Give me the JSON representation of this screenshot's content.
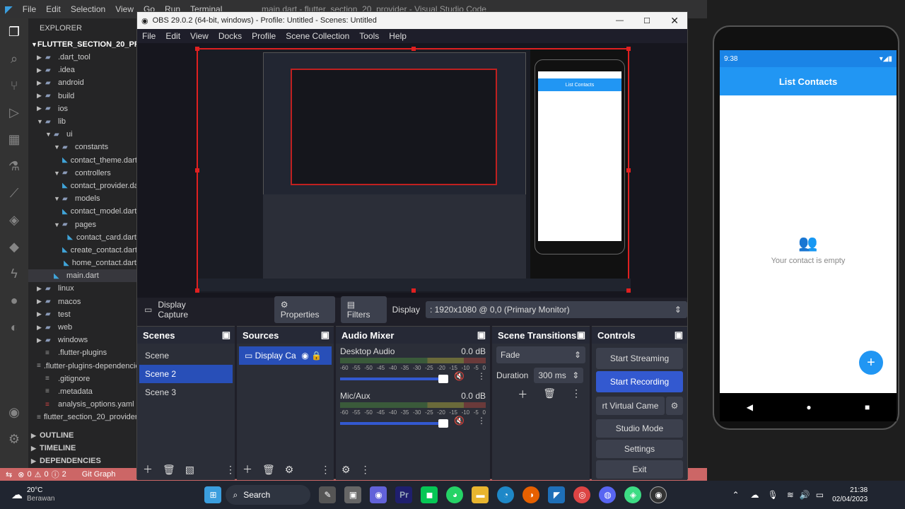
{
  "vscode": {
    "menus": [
      "File",
      "Edit",
      "Selection",
      "View",
      "Go",
      "Run",
      "Terminal",
      "Help"
    ],
    "title": "main.dart - flutter_section_20_provider - Visual Studio Code",
    "explorer_label": "EXPLORER",
    "project": "FLUTTER_SECTION_20_PROVIDER",
    "tree": [
      {
        "label": ".dart_tool",
        "indent": 1,
        "type": "folder",
        "open": false
      },
      {
        "label": ".idea",
        "indent": 1,
        "type": "folder",
        "open": false
      },
      {
        "label": "android",
        "indent": 1,
        "type": "folder",
        "open": false
      },
      {
        "label": "build",
        "indent": 1,
        "type": "folder",
        "open": false
      },
      {
        "label": "ios",
        "indent": 1,
        "type": "folder",
        "open": false
      },
      {
        "label": "lib",
        "indent": 1,
        "type": "folder",
        "open": true
      },
      {
        "label": "ui",
        "indent": 2,
        "type": "folder",
        "open": true
      },
      {
        "label": "constants",
        "indent": 3,
        "type": "folder",
        "open": true
      },
      {
        "label": "contact_theme.dart",
        "indent": 4,
        "type": "dart"
      },
      {
        "label": "controllers",
        "indent": 3,
        "type": "folder",
        "open": true
      },
      {
        "label": "contact_provider.dart",
        "indent": 4,
        "type": "dart"
      },
      {
        "label": "models",
        "indent": 3,
        "type": "folder",
        "open": true
      },
      {
        "label": "contact_model.dart",
        "indent": 4,
        "type": "dart"
      },
      {
        "label": "pages",
        "indent": 3,
        "type": "folder",
        "open": true
      },
      {
        "label": "contact_card.dart",
        "indent": 4,
        "type": "dart"
      },
      {
        "label": "create_contact.dart",
        "indent": 4,
        "type": "dart"
      },
      {
        "label": "home_contact.dart",
        "indent": 4,
        "type": "dart"
      },
      {
        "label": "main.dart",
        "indent": 2,
        "type": "dart",
        "active": true
      },
      {
        "label": "linux",
        "indent": 1,
        "type": "folder",
        "open": false
      },
      {
        "label": "macos",
        "indent": 1,
        "type": "folder",
        "open": false
      },
      {
        "label": "test",
        "indent": 1,
        "type": "folder",
        "open": false
      },
      {
        "label": "web",
        "indent": 1,
        "type": "folder",
        "open": false
      },
      {
        "label": "windows",
        "indent": 1,
        "type": "folder",
        "open": false
      },
      {
        "label": ".flutter-plugins",
        "indent": 1,
        "type": "file"
      },
      {
        "label": ".flutter-plugins-dependencies",
        "indent": 1,
        "type": "file"
      },
      {
        "label": ".gitignore",
        "indent": 1,
        "type": "file"
      },
      {
        "label": ".metadata",
        "indent": 1,
        "type": "file"
      },
      {
        "label": "analysis_options.yaml",
        "indent": 1,
        "type": "yaml"
      },
      {
        "label": "flutter_section_20_provider.iml",
        "indent": 1,
        "type": "file"
      }
    ],
    "sections": [
      "OUTLINE",
      "TIMELINE",
      "DEPENDENCIES"
    ],
    "status": {
      "errors": "0",
      "warnings": "0",
      "info": "2",
      "git": "Git Graph"
    }
  },
  "obs": {
    "title": "OBS 29.0.2 (64-bit, windows) - Profile: Untitled - Scenes: Untitled",
    "menus": [
      "File",
      "Edit",
      "View",
      "Docks",
      "Profile",
      "Scene Collection",
      "Tools",
      "Help"
    ],
    "source_label": "Display Capture",
    "properties": "Properties",
    "filters": "Filters",
    "display_label": "Display",
    "display_value": ": 1920x1080 @ 0,0 (Primary Monitor)",
    "panels": {
      "scenes": {
        "title": "Scenes",
        "items": [
          "Scene",
          "Scene 2",
          "Scene 3"
        ],
        "selected": 1
      },
      "sources": {
        "title": "Sources",
        "items": [
          "Display Ca"
        ]
      },
      "mixer": {
        "title": "Audio Mixer",
        "channels": [
          {
            "name": "Desktop Audio",
            "db": "0.0 dB",
            "level": 0.95
          },
          {
            "name": "Mic/Aux",
            "db": "0.0 dB",
            "level": 0.95
          }
        ],
        "scale": [
          "-60",
          "-55",
          "-50",
          "-45",
          "-40",
          "-35",
          "-30",
          "-25",
          "-20",
          "-15",
          "-10",
          "-5",
          "0"
        ]
      },
      "transitions": {
        "title": "Scene Transitions",
        "type": "Fade",
        "duration_label": "Duration",
        "duration": "300 ms"
      },
      "controls": {
        "title": "Controls",
        "buttons": [
          "Start Streaming",
          "Start Recording",
          "rt Virtual Camе",
          "Studio Mode",
          "Settings",
          "Exit"
        ]
      }
    }
  },
  "phone": {
    "time": "9:38",
    "title": "List Contacts",
    "empty_text": "Your contact is empty",
    "fab": "+"
  },
  "taskbar": {
    "temp": "20°C",
    "weather": "Berawan",
    "search": "Search",
    "time": "21:38",
    "date": "02/04/2023"
  },
  "colors": {
    "obs_blue": "#3359d0",
    "flutter_blue": "#2196f3",
    "vsc_status": "#cc6666"
  }
}
